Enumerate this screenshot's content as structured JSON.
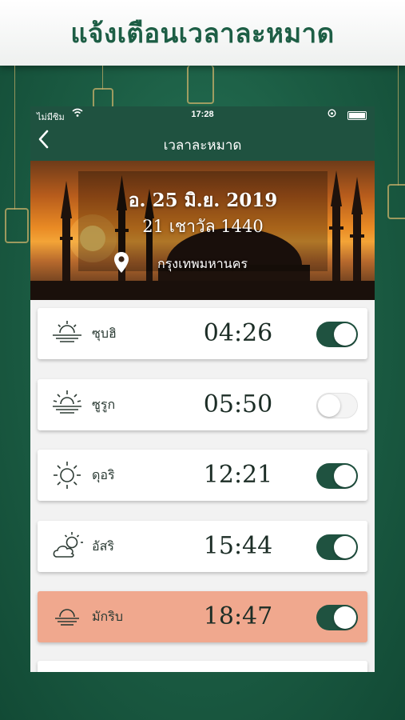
{
  "banner": {
    "title": "แจ้งเตือนเวลาละหมาด"
  },
  "status_bar": {
    "carrier": "ไม่มีซิม",
    "time": "17:28"
  },
  "nav": {
    "title": "เวลาละหมาด",
    "back_icon": "chevron-left-icon"
  },
  "header": {
    "gregorian_date": "อ. 25 มิ.ย. 2019",
    "hijri_date": "21 เชาวัล 1440",
    "location": "กรุงเทพมหานคร"
  },
  "prayers": [
    {
      "name": "ซุบฮิ",
      "time": "04:26",
      "icon": "sunrise-icon",
      "enabled": true,
      "highlighted": false
    },
    {
      "name": "ซูรูก",
      "time": "05:50",
      "icon": "sunrise-rays-icon",
      "enabled": false,
      "highlighted": false
    },
    {
      "name": "ดุอริ",
      "time": "12:21",
      "icon": "sun-icon",
      "enabled": true,
      "highlighted": false
    },
    {
      "name": "อัสริ",
      "time": "15:44",
      "icon": "partly-cloudy-icon",
      "enabled": true,
      "highlighted": false
    },
    {
      "name": "มักริบ",
      "time": "18:47",
      "icon": "sunset-icon",
      "enabled": true,
      "highlighted": true
    }
  ],
  "colors": {
    "primary_green": "#1f5240",
    "highlight_salmon": "#f0a88e",
    "background_green": "#1b5c43"
  }
}
